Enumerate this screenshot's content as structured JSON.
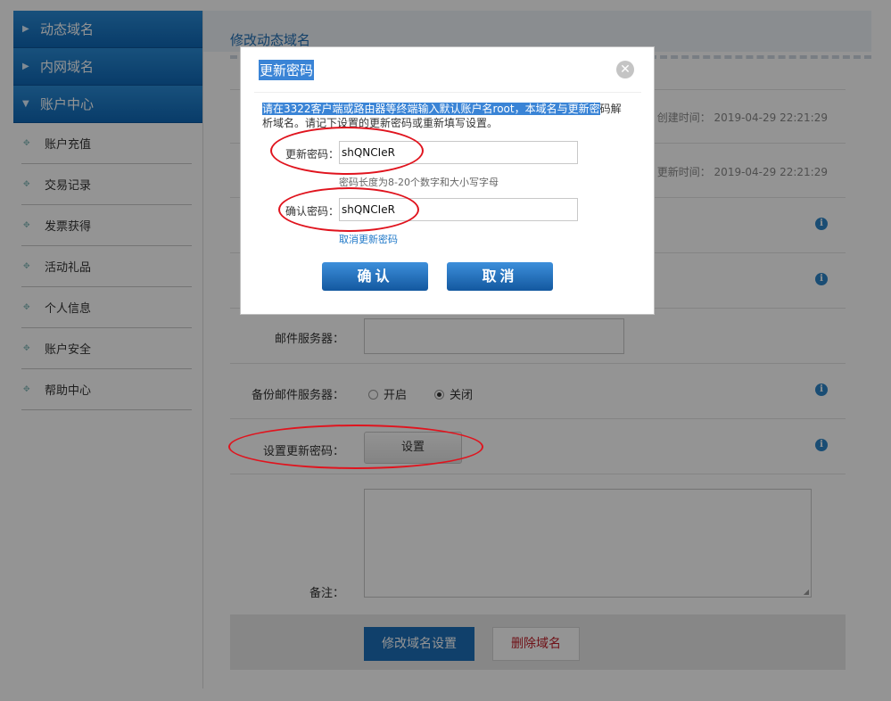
{
  "sidebar": {
    "sections": [
      {
        "label": "动态域名",
        "arrow": "▶"
      },
      {
        "label": "内网域名",
        "arrow": "▶"
      },
      {
        "label": "账户中心",
        "arrow": "▼"
      }
    ],
    "items": [
      "账户充值",
      "交易记录",
      "发票获得",
      "活动礼品",
      "个人信息",
      "账户安全",
      "帮助中心"
    ]
  },
  "main": {
    "title": "修改动态域名",
    "created_label": "创建时间：",
    "created_value": "2019-04-29 22:21:29",
    "updated_label": "更新时间：",
    "updated_value": "2019-04-29 22:21:29",
    "mail_server_label": "邮件服务器：",
    "backup_mail_label": "备份邮件服务器：",
    "backup_on": "开启",
    "backup_off": "关闭",
    "backup_selected": "关闭",
    "update_pwd_label": "设置更新密码：",
    "set_button": "设置",
    "remark_label": "备注：",
    "save_button": "修改域名设置",
    "delete_button": "删除域名"
  },
  "dialog": {
    "title": "更新密码",
    "desc_highlight": "请在3322客户端或路由器等终端输入默认账户名root，本域名与更新密",
    "desc_rest_1": "码解",
    "desc_rest_2": "析域名。请记下设置的更新密码或重新填写设置。",
    "pwd_label": "更新密码：",
    "pwd_value": "shQNCIeR",
    "pwd_hint": "密码长度为8-20个数字和大小写字母",
    "confirm_label": "确认密码：",
    "confirm_value": "shQNCIeR",
    "cancel_link": "取消更新密码",
    "ok_button": "确认",
    "cancel_button": "取消",
    "close_icon": "close-icon"
  },
  "colors": {
    "accent": "#1d6fb8",
    "annotation": "#e0141e",
    "delete": "#c0202a"
  }
}
